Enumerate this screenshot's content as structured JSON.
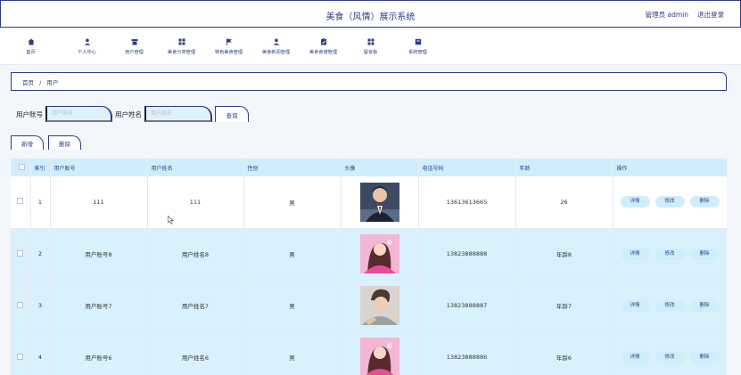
{
  "header": {
    "title": "美食（风情）展示系统",
    "admin_label": "管理员 admin",
    "logout_label": "退出登录"
  },
  "nav": [
    {
      "label": "首页",
      "icon": "home-icon"
    },
    {
      "label": "个人中心",
      "icon": "user-icon"
    },
    {
      "label": "用户管理",
      "icon": "users-icon"
    },
    {
      "label": "美食分类管理",
      "icon": "grid-icon"
    },
    {
      "label": "特色美食管理",
      "icon": "flag-icon"
    },
    {
      "label": "美食新闻管理",
      "icon": "person-icon"
    },
    {
      "label": "美食食谱管理",
      "icon": "clipboard-icon"
    },
    {
      "label": "留言板",
      "icon": "grid-icon"
    },
    {
      "label": "系统管理",
      "icon": "archive-icon"
    }
  ],
  "breadcrumb": {
    "home": "首页",
    "sep": "/",
    "current": "用户"
  },
  "search": {
    "account_label": "用户账号",
    "account_placeholder": "用户账号",
    "name_label": "用户姓名",
    "name_placeholder": "用户姓名",
    "query_label": "查询"
  },
  "actions": {
    "add_label": "新增",
    "delete_label": "删除"
  },
  "table": {
    "headers": [
      "索引",
      "用户账号",
      "用户姓名",
      "性别",
      "头像",
      "电话号码",
      "年龄",
      "操作"
    ],
    "rows": [
      {
        "index": "1",
        "account": "111",
        "name": "111",
        "gender": "男",
        "avatar": "male-suit-photo",
        "phone": "13613613665",
        "age": "26"
      },
      {
        "index": "2",
        "account": "用户账号8",
        "name": "用户姓名8",
        "gender": "男",
        "avatar": "female-pink-photo",
        "phone": "13823888888",
        "age": "年龄8"
      },
      {
        "index": "3",
        "account": "用户账号7",
        "name": "用户姓名7",
        "gender": "男",
        "avatar": "male-casual-photo",
        "phone": "13823888887",
        "age": "年龄7"
      },
      {
        "index": "4",
        "account": "用户账号6",
        "name": "用户姓名6",
        "gender": "男",
        "avatar": "female-pink-photo",
        "phone": "13823888886",
        "age": "年龄6"
      }
    ],
    "row_buttons": {
      "detail": "详情",
      "edit": "修改",
      "delete": "删除"
    }
  },
  "colors": {
    "accent": "#2c3d87",
    "light_blue": "#cfeefb",
    "row_alt": "#d8f1fc"
  }
}
